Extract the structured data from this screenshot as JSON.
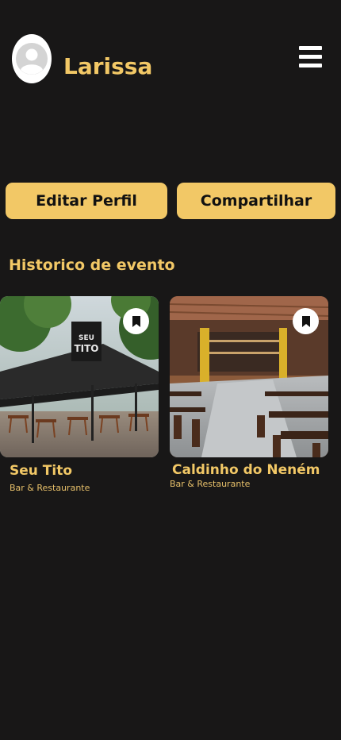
{
  "profile": {
    "name": "Larissa",
    "avatar_icon": "user-silhouette-icon",
    "menu_icon": "hamburger-menu-icon"
  },
  "actions": {
    "edit_label": "Editar Perfil",
    "share_label": "Compartilhar"
  },
  "history": {
    "title": "Historico de evento",
    "items": [
      {
        "name": "Seu Tito",
        "category": "Bar & Restaurante",
        "icon": "bookmark-icon"
      },
      {
        "name": "Caldinho do Neném",
        "category": "Bar & Restaurante",
        "icon": "bookmark-icon"
      }
    ]
  },
  "colors": {
    "background": "#181717",
    "accent": "#f2c866",
    "button_text": "#111111"
  }
}
